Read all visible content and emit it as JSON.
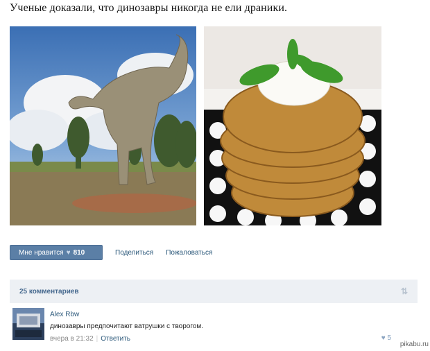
{
  "post": {
    "text": "Ученые доказали, что динозавры никогда не ели драники."
  },
  "actions": {
    "like_label": "Мне нравится",
    "like_count": "810",
    "share_label": "Поделиться",
    "report_label": "Пожаловаться"
  },
  "comments": {
    "header": "25 комментариев",
    "items": [
      {
        "author": "Alex Rbw",
        "text": "динозавры предпочитают ватрушки с творогом.",
        "time": "вчера в 21:32",
        "separator": "|",
        "reply_label": "Ответить",
        "likes": "5"
      }
    ]
  },
  "watermark": "pikabu.ru",
  "icons": {
    "heart": "heart-icon",
    "sort": "sort-icon"
  },
  "colors": {
    "like_button": "#5b7fa6",
    "link": "#2b587a",
    "comments_header_bg": "#edf0f4"
  }
}
